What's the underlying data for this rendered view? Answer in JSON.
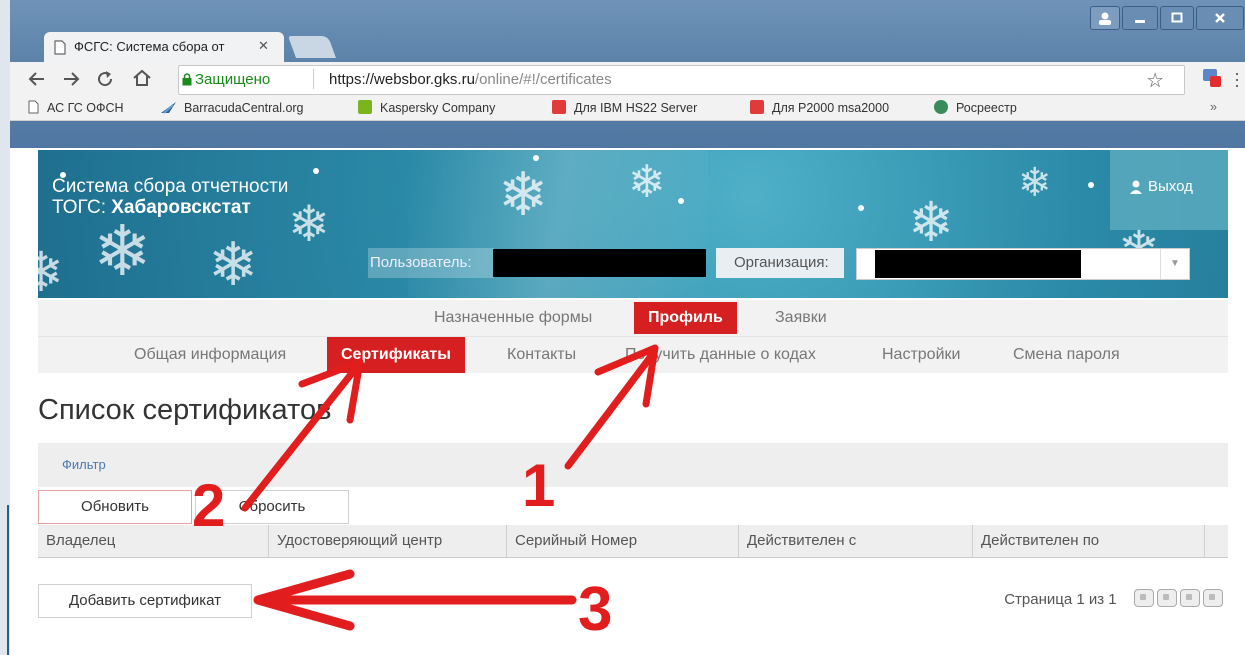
{
  "browser": {
    "tab_title": "ФСГС: Система сбора от",
    "tab_close": "✕",
    "secure_label": "Защищено",
    "url_domain": "https://websbor.gks.ru",
    "url_path": "/online/#!/certificates",
    "bookmarks": [
      {
        "label": "АС ГС ОФСН",
        "color": "#ffffff"
      },
      {
        "label": "BarracudaCentral.org",
        "color": "#2a5d9a"
      },
      {
        "label": "Kaspersky Company",
        "color": "#7ab51d"
      },
      {
        "label": "Для IBM HS22 Server",
        "color": "#e03a3a"
      },
      {
        "label": "Для P2000 msa2000",
        "color": "#e03a3a"
      },
      {
        "label": "Росреестр",
        "color": "#3a8a5c"
      }
    ],
    "bookmarks_more": "»"
  },
  "header": {
    "system_title": "Система сбора отчетности",
    "tops_prefix": "ТОГС: ",
    "tops_name": "Хабаровскстат",
    "exit_label": "Выход",
    "user_label": "Пользователь:",
    "org_label": "Организация:"
  },
  "menu_main": [
    {
      "label": "Назначенные формы",
      "active": false
    },
    {
      "label": "Профиль",
      "active": true
    },
    {
      "label": "Заявки",
      "active": false
    }
  ],
  "menu_sub": [
    {
      "label": "Общая информация",
      "active": false
    },
    {
      "label": "Сертификаты",
      "active": true
    },
    {
      "label": "Контакты",
      "active": false
    },
    {
      "label": "Получить данные о кодах",
      "active": false
    },
    {
      "label": "Настройки",
      "active": false
    },
    {
      "label": "Смена пароля",
      "active": false
    }
  ],
  "page": {
    "heading": "Список сертификатов",
    "filter_label": "Фильтр",
    "refresh_button": "Обновить",
    "reset_button": "Сбросить",
    "columns": [
      "Владелец",
      "Удостоверяющий центр",
      "Серийный Номер",
      "Действителен с",
      "Действителен по"
    ],
    "add_button": "Добавить сертификат",
    "pager_text": "Страница 1 из 1"
  },
  "annotations": {
    "one": "1",
    "two": "2",
    "three": "3",
    "color": "#e21d1d"
  }
}
